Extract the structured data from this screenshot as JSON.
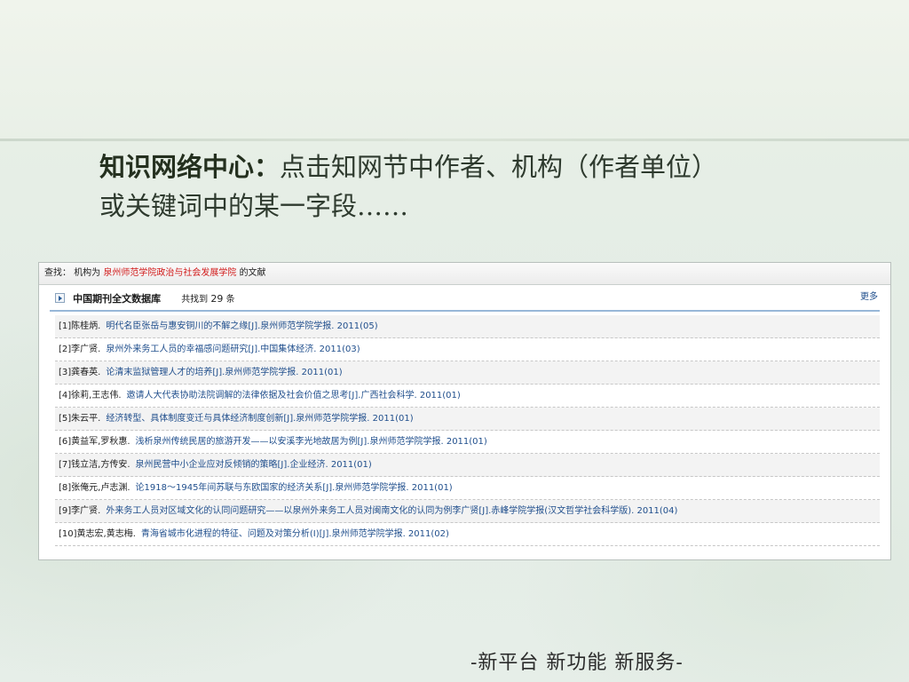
{
  "slide": {
    "title_lead": "知识网络中心：",
    "title_line1": "点击知网节中作者、机构（作者单位）",
    "title_line2": "或关键词中的某一字段……",
    "footer": "-新平台 新功能 新服务-"
  },
  "search": {
    "find_label": "查找：",
    "field_prefix": "机构为",
    "institution": "泉州师范学院政治与社会发展学院",
    "suffix": "的文献"
  },
  "database": {
    "name": "中国期刊全文数据库",
    "found_prefix": "共找到",
    "count": "29",
    "count_unit": "条",
    "more_label": "更多"
  },
  "results": [
    {
      "idx": "[1]",
      "authors": "陈桂炳.",
      "title": "明代名臣张岳与惠安铜川的不解之缘[J].",
      "source": "泉州师范学院学报. 2011(05)"
    },
    {
      "idx": "[2]",
      "authors": "李广贤.",
      "title": "泉州外来务工人员的幸福感问题研究[J].",
      "source": "中国集体经济. 2011(03)"
    },
    {
      "idx": "[3]",
      "authors": "龚春英.",
      "title": "论清末监狱管理人才的培养[J].",
      "source": "泉州师范学院学报. 2011(01)"
    },
    {
      "idx": "[4]",
      "authors": "徐莉,王志伟.",
      "title": "邀请人大代表协助法院调解的法律依据及社会价值之思考[J].",
      "source": "广西社会科学. 2011(01)"
    },
    {
      "idx": "[5]",
      "authors": "朱云平.",
      "title": "经济转型、具体制度变迁与具体经济制度创新[J].",
      "source": "泉州师范学院学报. 2011(01)"
    },
    {
      "idx": "[6]",
      "authors": "黄益军,罗秋惠.",
      "title": "浅析泉州传统民居的旅游开发——以安溪李光地故居为例[J].",
      "source": "泉州师范学院学报. 2011(01)"
    },
    {
      "idx": "[7]",
      "authors": "钱立洁,方传安.",
      "title": "泉州民营中小企业应对反倾销的策略[J].",
      "source": "企业经济. 2011(01)"
    },
    {
      "idx": "[8]",
      "authors": "张俺元,卢志渊.",
      "title": "论1918～1945年间苏联与东欧国家的经济关系[J].",
      "source": "泉州师范学院学报. 2011(01)"
    },
    {
      "idx": "[9]",
      "authors": "李广贤.",
      "title": "外来务工人员对区域文化的认同问题研究——以泉州外来务工人员对闽南文化的认同为例李广贤[J].",
      "source": "赤峰学院学报(汉文哲学社会科学版). 2011(04)"
    },
    {
      "idx": "[10]",
      "authors": "黄志宏,黄志梅.",
      "title": "青海省城市化进程的特征、问题及对策分析(Ⅰ)[J].",
      "source": "泉州师范学院学报. 2011(02)"
    }
  ]
}
